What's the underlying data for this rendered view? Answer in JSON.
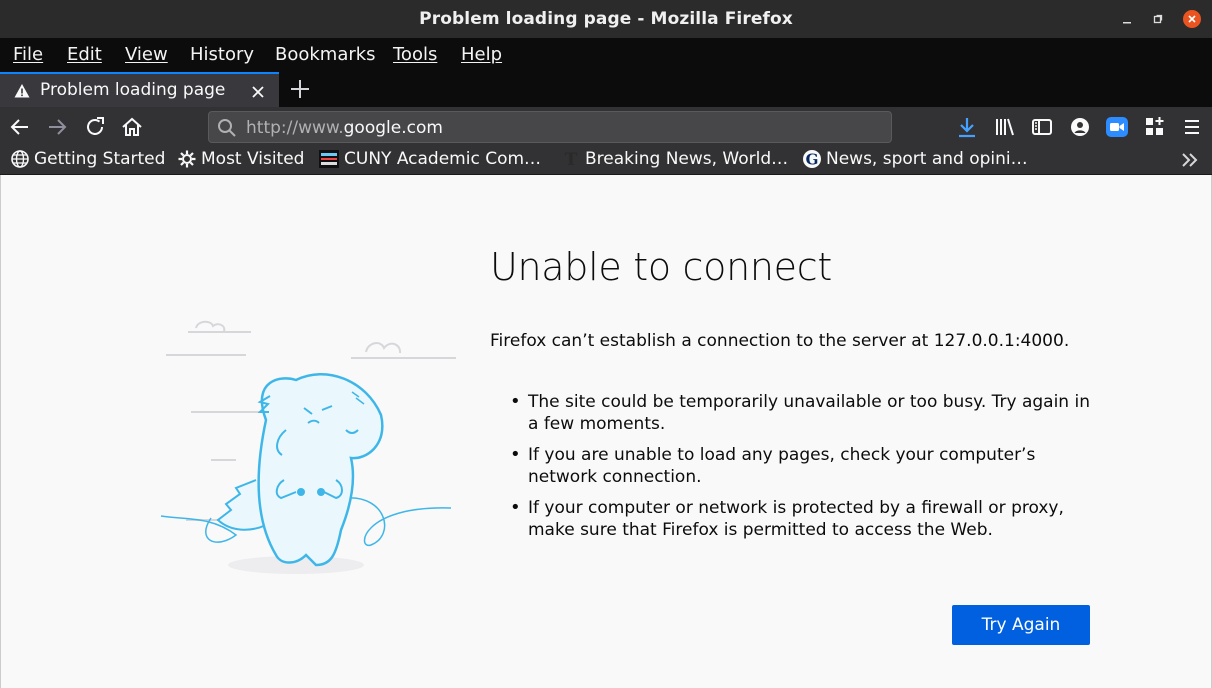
{
  "window": {
    "title": "Problem loading page - Mozilla Firefox"
  },
  "menu": [
    {
      "label": "File"
    },
    {
      "label": "Edit"
    },
    {
      "label": "View"
    },
    {
      "label": "History"
    },
    {
      "label": "Bookmarks"
    },
    {
      "label": "Tools"
    },
    {
      "label": "Help"
    }
  ],
  "tab": {
    "label": "Problem loading page"
  },
  "navbar": {
    "url_prefix": "http://www.",
    "url_domain": "google.com"
  },
  "bookmarks": [
    {
      "label": "Getting Started"
    },
    {
      "label": "Most Visited"
    },
    {
      "label": "CUNY Academic Com…"
    },
    {
      "label": "Breaking News, World…"
    },
    {
      "label": "News, sport and opini…"
    }
  ],
  "error": {
    "title": "Unable to connect",
    "description": "Firefox can’t establish a connection to the server at 127.0.0.1:4000.",
    "bullets": [
      "The site could be temporarily unavailable or too busy. Try again in a few moments.",
      "If you are unable to load any pages, check your computer’s network connection.",
      "If your computer or network is protected by a firewall or proxy, make sure that Firefox is permitted to access the Web."
    ],
    "button": "Try Again"
  },
  "colors": {
    "accent": "#0060df",
    "close_button": "#e95420",
    "illustration": "#3fb6e8"
  }
}
